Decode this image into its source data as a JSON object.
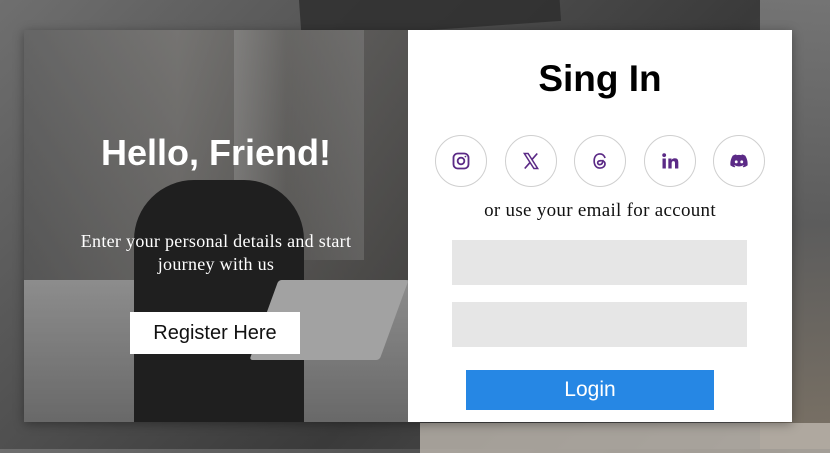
{
  "left_panel": {
    "heading": "Hello, Friend!",
    "intro": "Enter your personal details and start journey with us",
    "register_label": "Register Here"
  },
  "right_panel": {
    "title": "Sing In",
    "alt_text": "or use your email for account",
    "socials": [
      {
        "icon": "instagram-icon"
      },
      {
        "icon": "x-icon"
      },
      {
        "icon": "threads-icon"
      },
      {
        "icon": "linkedin-icon"
      },
      {
        "icon": "discord-icon"
      }
    ],
    "email_value": "",
    "password_value": "",
    "login_label": "Login"
  },
  "colors": {
    "accent": "#2687e4",
    "social_icon": "#5b2a86",
    "field_bg": "#e6e6e6"
  }
}
